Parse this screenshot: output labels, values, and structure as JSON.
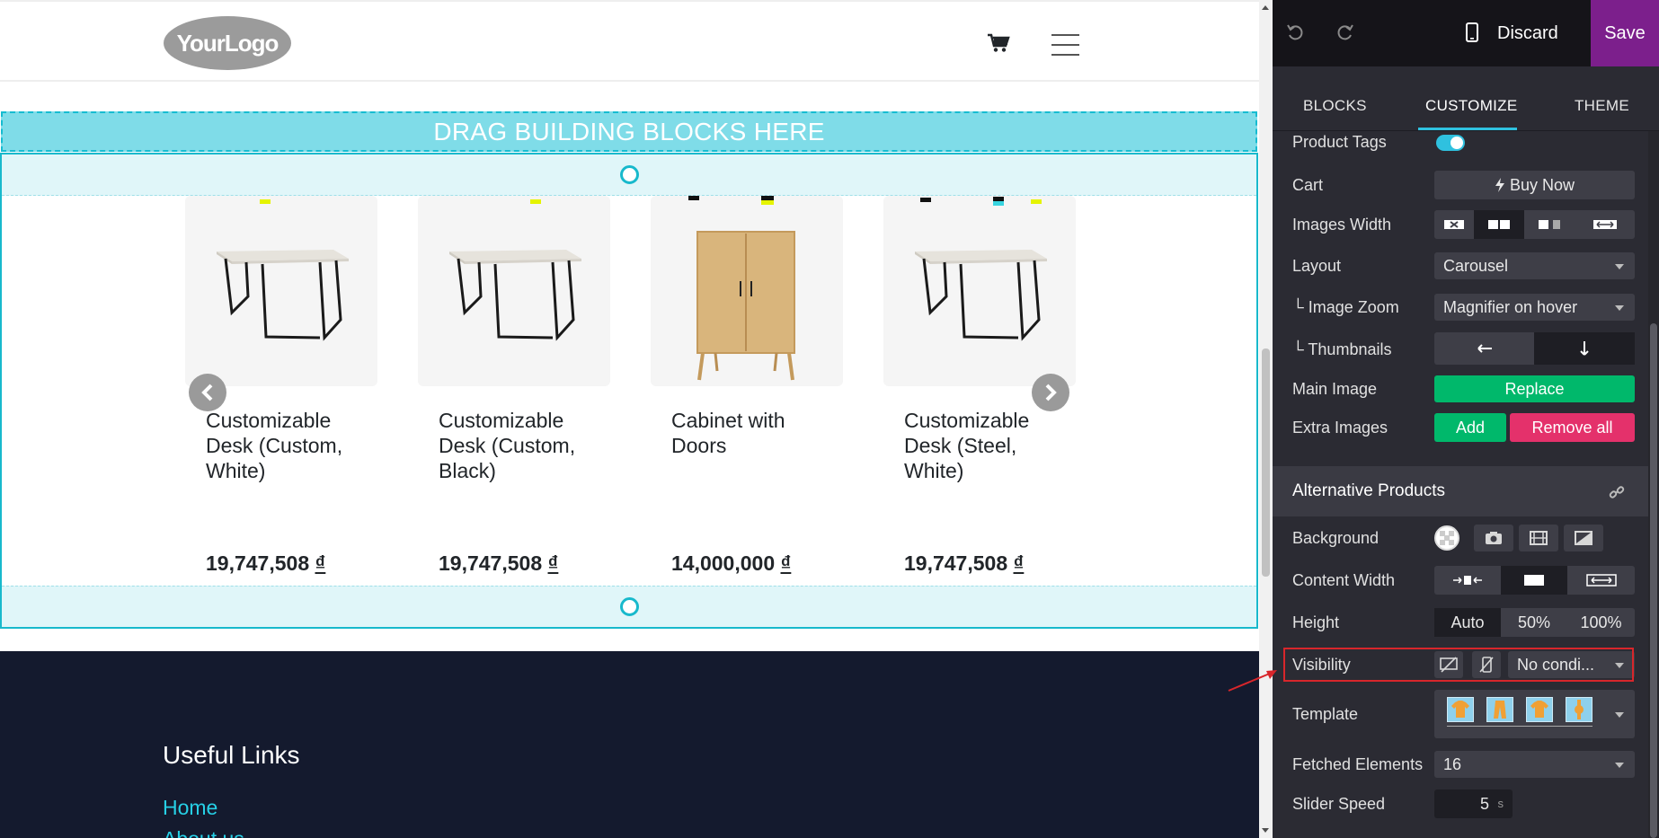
{
  "site": {
    "logo_text": "YourLogo",
    "drop_zone_text": "DRAG BUILDING BLOCKS HERE",
    "products": [
      {
        "name": "Customizable Desk (Custom, White)",
        "price": "19,747,508",
        "currency": "₫",
        "image": "desk-white"
      },
      {
        "name": "Customizable Desk (Custom, Black)",
        "price": "19,747,508",
        "currency": "₫",
        "image": "desk-white"
      },
      {
        "name": "Cabinet with Doors",
        "price": "14,000,000",
        "currency": "₫",
        "image": "cabinet"
      },
      {
        "name": "Customizable Desk (Steel, White)",
        "price": "19,747,508",
        "currency": "₫",
        "image": "desk-white"
      }
    ],
    "footer": {
      "title": "Useful Links",
      "links": [
        "Home",
        "About us"
      ]
    }
  },
  "editor": {
    "discard_label": "Discard",
    "save_label": "Save",
    "tabs": [
      "BLOCKS",
      "CUSTOMIZE",
      "THEME"
    ],
    "active_tab": "CUSTOMIZE",
    "options": {
      "product_tags": {
        "label": "Product Tags",
        "enabled": true
      },
      "cart": {
        "label": "Cart",
        "value": "Buy Now"
      },
      "images_width": {
        "label": "Images Width"
      },
      "layout": {
        "label": "Layout",
        "value": "Carousel"
      },
      "image_zoom": {
        "label": "└ Image Zoom",
        "value": "Magnifier on hover"
      },
      "thumbnails": {
        "label": "└ Thumbnails"
      },
      "main_image": {
        "label": "Main Image",
        "button": "Replace"
      },
      "extra_images": {
        "label": "Extra Images",
        "add": "Add",
        "remove": "Remove all"
      }
    },
    "alt_section": {
      "title": "Alternative Products",
      "background": {
        "label": "Background"
      },
      "content_width": {
        "label": "Content Width"
      },
      "height": {
        "label": "Height",
        "options": [
          "Auto",
          "50%",
          "100%"
        ],
        "selected": "Auto"
      },
      "visibility": {
        "label": "Visibility",
        "condition": "No condi..."
      },
      "template": {
        "label": "Template"
      },
      "fetched": {
        "label": "Fetched Elements",
        "value": "16"
      },
      "slider_speed": {
        "label": "Slider Speed",
        "value": "5",
        "unit": "s"
      }
    }
  },
  "colors": {
    "accent": "#2fc1df",
    "save": "#7c1f8c",
    "green": "#00b86b",
    "pink": "#e4316b",
    "highlight": "#d8262b"
  }
}
